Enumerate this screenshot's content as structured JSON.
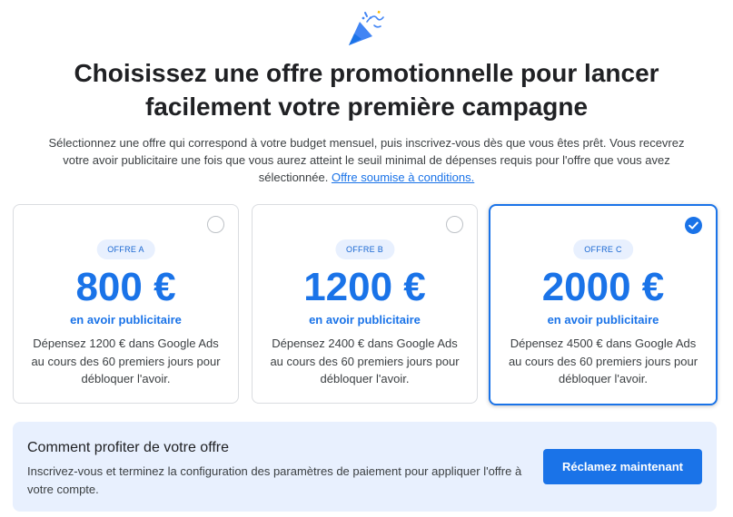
{
  "header": {
    "title_line1": "Choisissez une offre promotionnelle pour lancer",
    "title_line2": "facilement votre première campagne",
    "subtitle": "Sélectionnez une offre qui correspond à votre budget mensuel, puis inscrivez-vous dès que vous êtes prêt. Vous recevrez votre avoir publicitaire une fois que vous aurez atteint le seuil minimal de dépenses requis pour l'offre que vous avez sélectionnée.",
    "terms_link": "Offre soumise à conditions."
  },
  "offers": [
    {
      "badge": "OFFRE A",
      "amount": "800 €",
      "credit_label": "en avoir publicitaire",
      "description": "Dépensez 1200 € dans Google Ads au cours des 60 premiers jours pour débloquer l'avoir.",
      "selected": false
    },
    {
      "badge": "OFFRE B",
      "amount": "1200 €",
      "credit_label": "en avoir publicitaire",
      "description": "Dépensez 2400 € dans Google Ads au cours des 60 premiers jours pour débloquer l'avoir.",
      "selected": false
    },
    {
      "badge": "OFFRE C",
      "amount": "2000 €",
      "credit_label": "en avoir publicitaire",
      "description": "Dépensez 4500 € dans Google Ads au cours des 60 premiers jours pour débloquer l'avoir.",
      "selected": true
    }
  ],
  "howto": {
    "title": "Comment profiter de votre offre",
    "text": "Inscrivez-vous et terminez la configuration des paramètres de paiement pour appliquer l'offre à votre compte.",
    "button_label": "Réclamez maintenant"
  },
  "colors": {
    "accent": "#1a73e8",
    "badge_bg": "#e8f0fe",
    "panel_bg": "#e8f0fe"
  },
  "icons": {
    "header": "party-popper-icon",
    "radio_checked": "check-icon"
  }
}
